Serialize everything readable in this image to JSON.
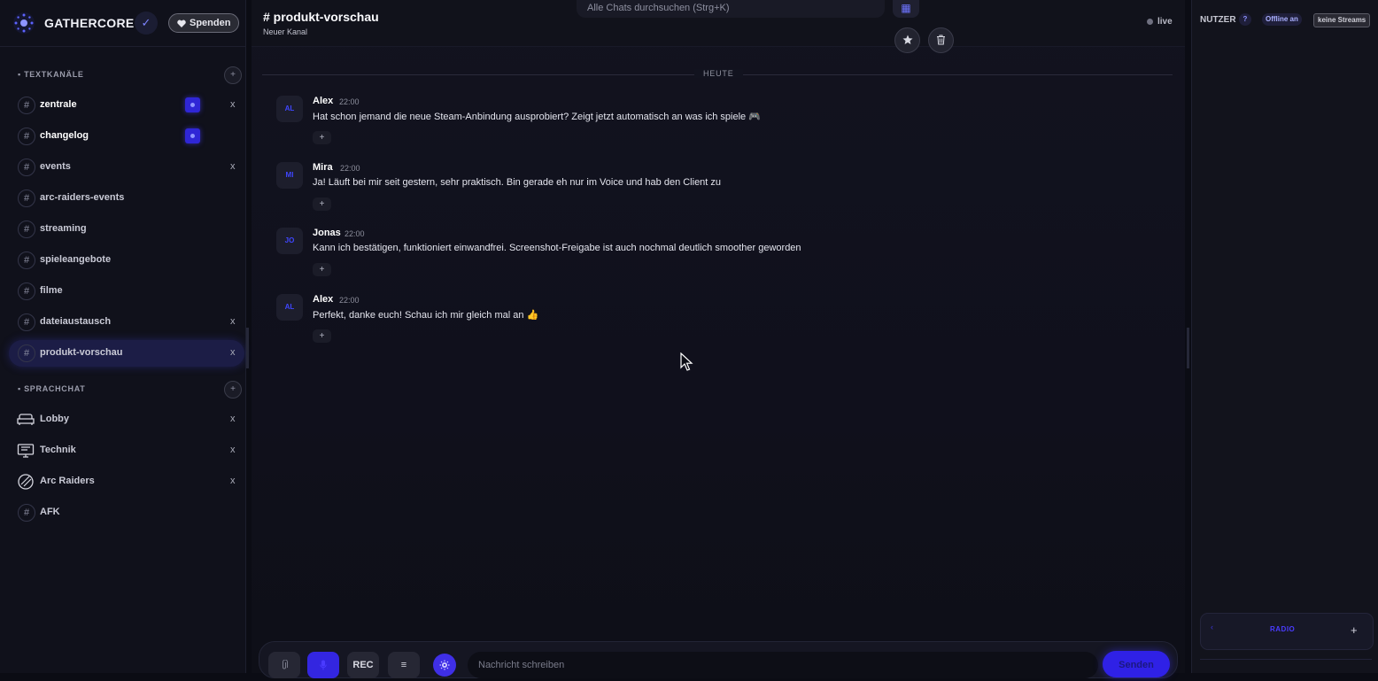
{
  "brand": {
    "name": "GATHERCORE",
    "verified_icon": "✓",
    "donate_label": "Spenden",
    "donate_icon": "heart-icon"
  },
  "text_section": {
    "title": "TEXTKANÄLE",
    "add_icon": "+"
  },
  "text_channels": [
    {
      "label": "zentrale",
      "bold": true,
      "badge": true,
      "close": "x"
    },
    {
      "label": "changelog",
      "bold": true,
      "badge": true,
      "close": ""
    },
    {
      "label": "events",
      "bold": false,
      "badge": false,
      "close": "x"
    },
    {
      "label": "arc-raiders-events",
      "bold": false,
      "badge": false,
      "close": ""
    },
    {
      "label": "streaming",
      "bold": false,
      "badge": false,
      "close": ""
    },
    {
      "label": "spieleangebote",
      "bold": false,
      "badge": false,
      "close": ""
    },
    {
      "label": "filme",
      "bold": false,
      "badge": false,
      "close": ""
    },
    {
      "label": "dateiaustausch",
      "bold": false,
      "badge": false,
      "close": "x"
    },
    {
      "label": "produkt-vorschau",
      "bold": false,
      "badge": false,
      "close": "x",
      "active": true
    }
  ],
  "voice_section": {
    "title": "SPRACHCHAT",
    "add_icon": "+"
  },
  "voice_channels": [
    {
      "label": "Lobby",
      "icon": "sofa-icon",
      "close": "x"
    },
    {
      "label": "Technik",
      "icon": "monitor-icon",
      "close": "x"
    },
    {
      "label": "Arc Raiders",
      "icon": "game-icon",
      "close": "x"
    },
    {
      "label": "AFK",
      "icon": "hash-icon",
      "close": ""
    }
  ],
  "header": {
    "channel_title": "# produkt-vorschau",
    "channel_subtitle": "Neuer Kanal",
    "search_placeholder": "Alle Chats durchsuchen (Strg+K)",
    "live_label": "live"
  },
  "day_separator": "HEUTE",
  "messages": [
    {
      "initials": "AL",
      "author": "Alex",
      "time": "22:00",
      "text": "Hat schon jemand die neue Steam-Anbindung ausprobiert? Zeigt jetzt automatisch an was ich spiele 🎮",
      "react": "+"
    },
    {
      "initials": "MI",
      "author": "Mira",
      "time": "22:00",
      "text": "Ja! Läuft bei mir seit gestern, sehr praktisch. Bin gerade eh nur im Voice und hab den Client zu",
      "react": "+"
    },
    {
      "initials": "JO",
      "author": "Jonas",
      "time": "22:00",
      "text": "Kann ich bestätigen, funktioniert einwandfrei. Screenshot-Freigabe ist auch nochmal deutlich smoother geworden",
      "react": "+"
    },
    {
      "initials": "AL",
      "author": "Alex",
      "time": "22:00",
      "text": "Perfekt, danke euch! Schau ich mir gleich mal an 👍",
      "react": "+"
    }
  ],
  "composer": {
    "rec_label": "REC",
    "menu_label": "≡",
    "placeholder": "Nachricht schreiben",
    "send_label": "Senden"
  },
  "right_panel": {
    "users_label": "NUTZER",
    "help_label": "?",
    "offline_label": "Offline an",
    "streams_label": "keine Streams",
    "radio_label": "RADIO",
    "radio_add": "+",
    "radio_chevron": "‹"
  },
  "colors": {
    "accent": "#3326e0",
    "background": "#0b0c14",
    "sidebar": "#10111b"
  }
}
